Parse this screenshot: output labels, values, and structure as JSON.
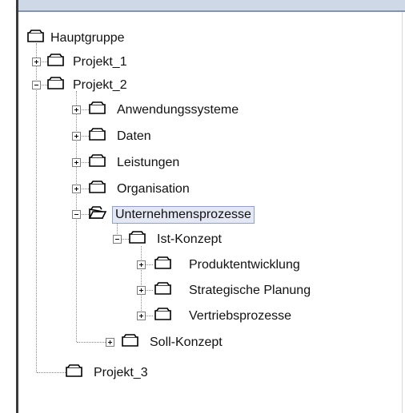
{
  "tree": {
    "root_label": "Hauptgruppe",
    "projekt1_label": "Projekt_1",
    "projekt2_label": "Projekt_2",
    "anwendungssysteme_label": "Anwendungssysteme",
    "daten_label": "Daten",
    "leistungen_label": "Leistungen",
    "organisation_label": "Organisation",
    "unternehmensprozesse_label": "Unternehmensprozesse",
    "ist_konzept_label": "Ist-Konzept",
    "produktentwicklung_label": "Produktentwicklung",
    "strategische_planung_label": "Strategische Planung",
    "vertriebsprozesse_label": "Vertriebsprozesse",
    "soll_konzept_label": "Soll-Konzept",
    "projekt3_label": "Projekt_3",
    "selected": "Unternehmensprozesse"
  },
  "icons": {
    "closed_folder": "folder-closed-icon",
    "open_folder": "folder-open-icon",
    "expand": "expand-plus-icon",
    "collapse": "collapse-minus-icon"
  }
}
